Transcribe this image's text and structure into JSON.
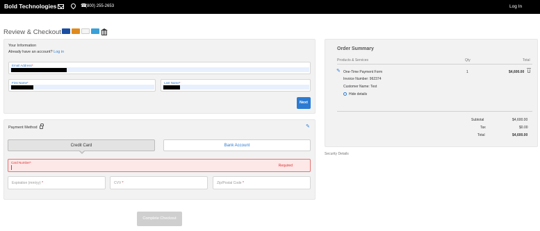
{
  "header": {
    "brand": "Bold Technologies",
    "phone": "(800) 255-2653",
    "login": "Log In",
    "icons": [
      "mail-icon",
      "location-pin-icon",
      "phone-icon"
    ]
  },
  "page": {
    "title": "Review & Checkout",
    "card_icons": [
      "visa-card-icon",
      "mastercard-icon",
      "discover-card-icon",
      "amex-card-icon",
      "bank-icon"
    ]
  },
  "info": {
    "heading": "Your Information",
    "account_prompt": "Already have an account?",
    "login_link": "Log in",
    "email_label": "Email Address",
    "first_name_label": "First Name",
    "last_name_label": "Last Name",
    "required_mark": "*",
    "next_label": "Next"
  },
  "payment": {
    "heading": "Payment Method",
    "credit_card_tab": "Credit Card",
    "bank_account_tab": "Bank Account",
    "card_number_label": "Card Number",
    "required_text": "Required",
    "expiration_placeholder": "Expiration (mm/yy)",
    "cvv_placeholder": "CVV",
    "zip_placeholder": "Zip/Postal Code",
    "required_mark": "*"
  },
  "complete_label": "Complete Checkout",
  "summary": {
    "title": "Order Summary",
    "col_products": "Products & Services",
    "col_qty": "Qty",
    "col_total": "Total",
    "item_name": "One-Time Payment Form",
    "invoice": "Invoice Number: 962374",
    "customer": "Customer Name: Test",
    "qty": "1",
    "item_total": "$4,600.00",
    "hide_details": "Hide details",
    "subtotal_label": "Subtotal",
    "subtotal_value": "$4,600.00",
    "tax_label": "Tax",
    "tax_value": "$0.00",
    "total_label": "Total",
    "total_value": "$4,600.00"
  },
  "security_details": "Security Details",
  "colors": {
    "accent": "#2b7bd3",
    "error": "#d33333",
    "header_bg": "#000000",
    "panel_bg": "#f2f2f2",
    "card_visa": "#1a4ea3",
    "card_mastercard": "#e08a1e",
    "card_discover": "#f5f5f5",
    "card_amex": "#3aa0d8"
  }
}
